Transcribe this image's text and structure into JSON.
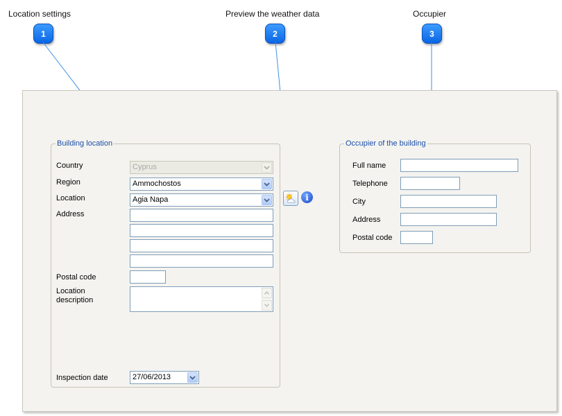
{
  "callouts": [
    {
      "number": "1",
      "title": "Location settings"
    },
    {
      "number": "2",
      "title": "Preview the weather data"
    },
    {
      "number": "3",
      "title": "Occupier"
    }
  ],
  "building_location": {
    "legend": "Building location",
    "country": {
      "label": "Country",
      "value": "Cyprus"
    },
    "region": {
      "label": "Region",
      "value": "Ammochostos"
    },
    "location": {
      "label": "Location",
      "value": "Agia Napa"
    },
    "address": {
      "label": "Address",
      "lines": [
        "",
        "",
        "",
        ""
      ]
    },
    "postal_code": {
      "label": "Postal code",
      "value": ""
    },
    "location_description": {
      "label_line1": "Location",
      "label_line2": "description",
      "value": ""
    },
    "inspection_date": {
      "label": "Inspection date",
      "value": "27/06/2013"
    }
  },
  "weather": {
    "preview_icon": "weather-sun-cloud-icon",
    "info_icon": "info-icon",
    "info_glyph": "i"
  },
  "occupier": {
    "legend": "Occupier of the building",
    "full_name": {
      "label": "Full name",
      "value": ""
    },
    "telephone": {
      "label": "Telephone",
      "value": ""
    },
    "city": {
      "label": "City",
      "value": ""
    },
    "address": {
      "label": "Address",
      "value": ""
    },
    "postal_code": {
      "label": "Postal code",
      "value": ""
    }
  },
  "colors": {
    "badge": "#1a78f5",
    "legend_text": "#1c4ea8",
    "callout_line": "#3f90e8",
    "panel_bg": "#f4f3ef"
  }
}
